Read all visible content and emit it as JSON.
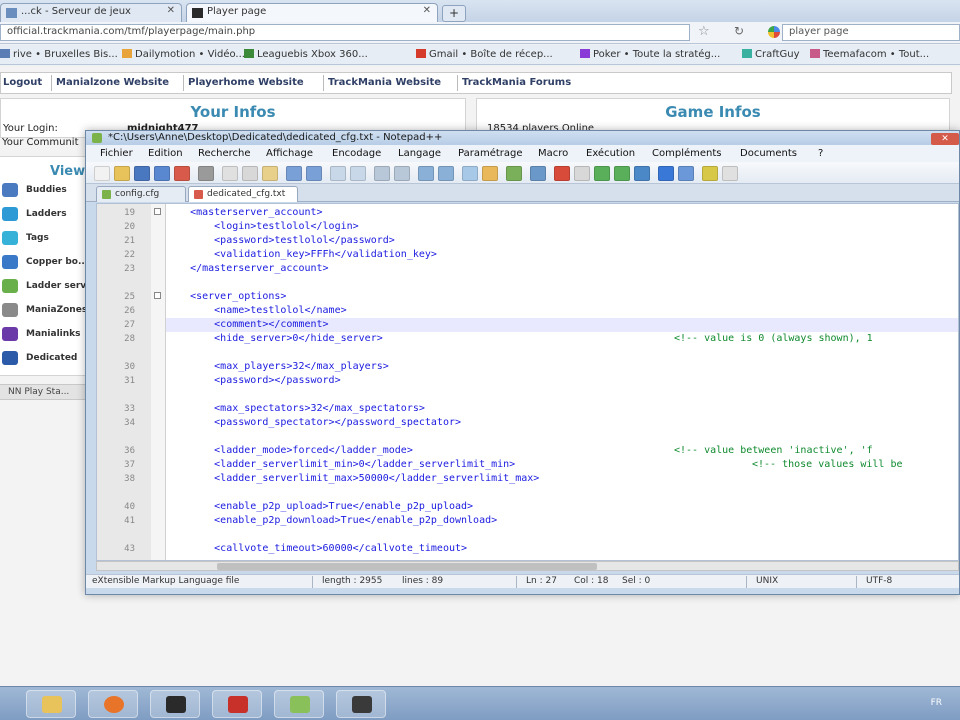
{
  "browser": {
    "tabs": [
      {
        "label": "...ck - Serveur de jeux",
        "active": false
      },
      {
        "label": "Player page",
        "active": true
      }
    ],
    "new_tab": "+",
    "url": "official.trackmania.com/tmf/playerpage/main.php",
    "search_placeholder": "player page",
    "bookmarks": [
      "rive • Bruxelles Bis...",
      "Dailymotion • Vidéo...",
      "Leaguebis Xbox 360...",
      "Gmail • Boîte de récep...",
      "Poker • Toute la stratég...",
      "CraftGuy",
      "Teemafacom • Tout..."
    ]
  },
  "webpage": {
    "nav": [
      "Logout",
      "Manialzone Website",
      "Playerhome Website",
      "TrackMania Website",
      "TrackMania Forums"
    ],
    "your_infos": {
      "title": "Your Infos",
      "login_label": "Your Login:",
      "login_value": "midnight477",
      "community_label": "Your Communit"
    },
    "game_infos": {
      "title": "Game Infos",
      "players": "18534 players Online"
    },
    "views_title": "View",
    "sidebar": [
      "Buddies",
      "Ladders",
      "Tags",
      "Copper bo...",
      "Ladder serv...",
      "ManiaZones",
      "Manialinks",
      "Dedicated"
    ],
    "subbar": "NN Play Sta..."
  },
  "notepad": {
    "title": "*C:\\Users\\Anne\\Desktop\\Dedicated\\dedicated_cfg.txt - Notepad++",
    "close": "✕",
    "menu": [
      "Fichier",
      "Edition",
      "Recherche",
      "Affichage",
      "Encodage",
      "Langage",
      "Paramétrage",
      "Macro",
      "Exécution",
      "Compléments",
      "Documents",
      "?"
    ],
    "doc_tabs": [
      "config.cfg",
      "dedicated_cfg.txt"
    ],
    "lines": [
      {
        "n": "19",
        "text": "    <masterserver_account>"
      },
      {
        "n": "20",
        "text": "        <login>testlolol</login>"
      },
      {
        "n": "21",
        "text": "        <password>testlolol</password>"
      },
      {
        "n": "22",
        "text": "        <validation_key>FFFh</validation_key>"
      },
      {
        "n": "23",
        "text": "    </masterserver_account>"
      },
      {
        "n": "",
        "text": ""
      },
      {
        "n": "25",
        "text": "    <server_options>"
      },
      {
        "n": "26",
        "text": "        <name>testlolol</name>"
      },
      {
        "n": "27",
        "text": "        <comment></comment>"
      },
      {
        "n": "28",
        "text": "        <hide_server>0</hide_server>",
        "comment": "<!-- value is 0 (always shown), 1"
      },
      {
        "n": "",
        "text": ""
      },
      {
        "n": "30",
        "text": "        <max_players>32</max_players>"
      },
      {
        "n": "31",
        "text": "        <password></password>"
      },
      {
        "n": "",
        "text": ""
      },
      {
        "n": "33",
        "text": "        <max_spectators>32</max_spectators>"
      },
      {
        "n": "34",
        "text": "        <password_spectator></password_spectator>"
      },
      {
        "n": "",
        "text": ""
      },
      {
        "n": "36",
        "text": "        <ladder_mode>forced</ladder_mode>",
        "comment": "<!-- value between 'inactive', 'f"
      },
      {
        "n": "37",
        "text": "        <ladder_serverlimit_min>0</ladder_serverlimit_min>",
        "comment": "<!-- those values will be"
      },
      {
        "n": "38",
        "text": "        <ladder_serverlimit_max>50000</ladder_serverlimit_max>"
      },
      {
        "n": "",
        "text": ""
      },
      {
        "n": "40",
        "text": "        <enable_p2p_upload>True</enable_p2p_upload>"
      },
      {
        "n": "41",
        "text": "        <enable_p2p_download>True</enable_p2p_download>"
      },
      {
        "n": "",
        "text": ""
      },
      {
        "n": "43",
        "text": "        <callvote_timeout>60000</callvote_timeout>"
      }
    ],
    "status": {
      "lang": "eXtensible Markup Language file",
      "length": "length : 2955",
      "lines": "lines : 89",
      "pos": "Ln : 27",
      "col": "Col : 18",
      "sel": "Sel : 0",
      "eol": "UNIX",
      "enc": "UTF-8"
    }
  },
  "taskbar": {
    "time": "FR"
  },
  "colors": {
    "accent": "#3a8ab2",
    "code_tag": "#1b1be0",
    "code_comment": "#0f8a2e"
  }
}
